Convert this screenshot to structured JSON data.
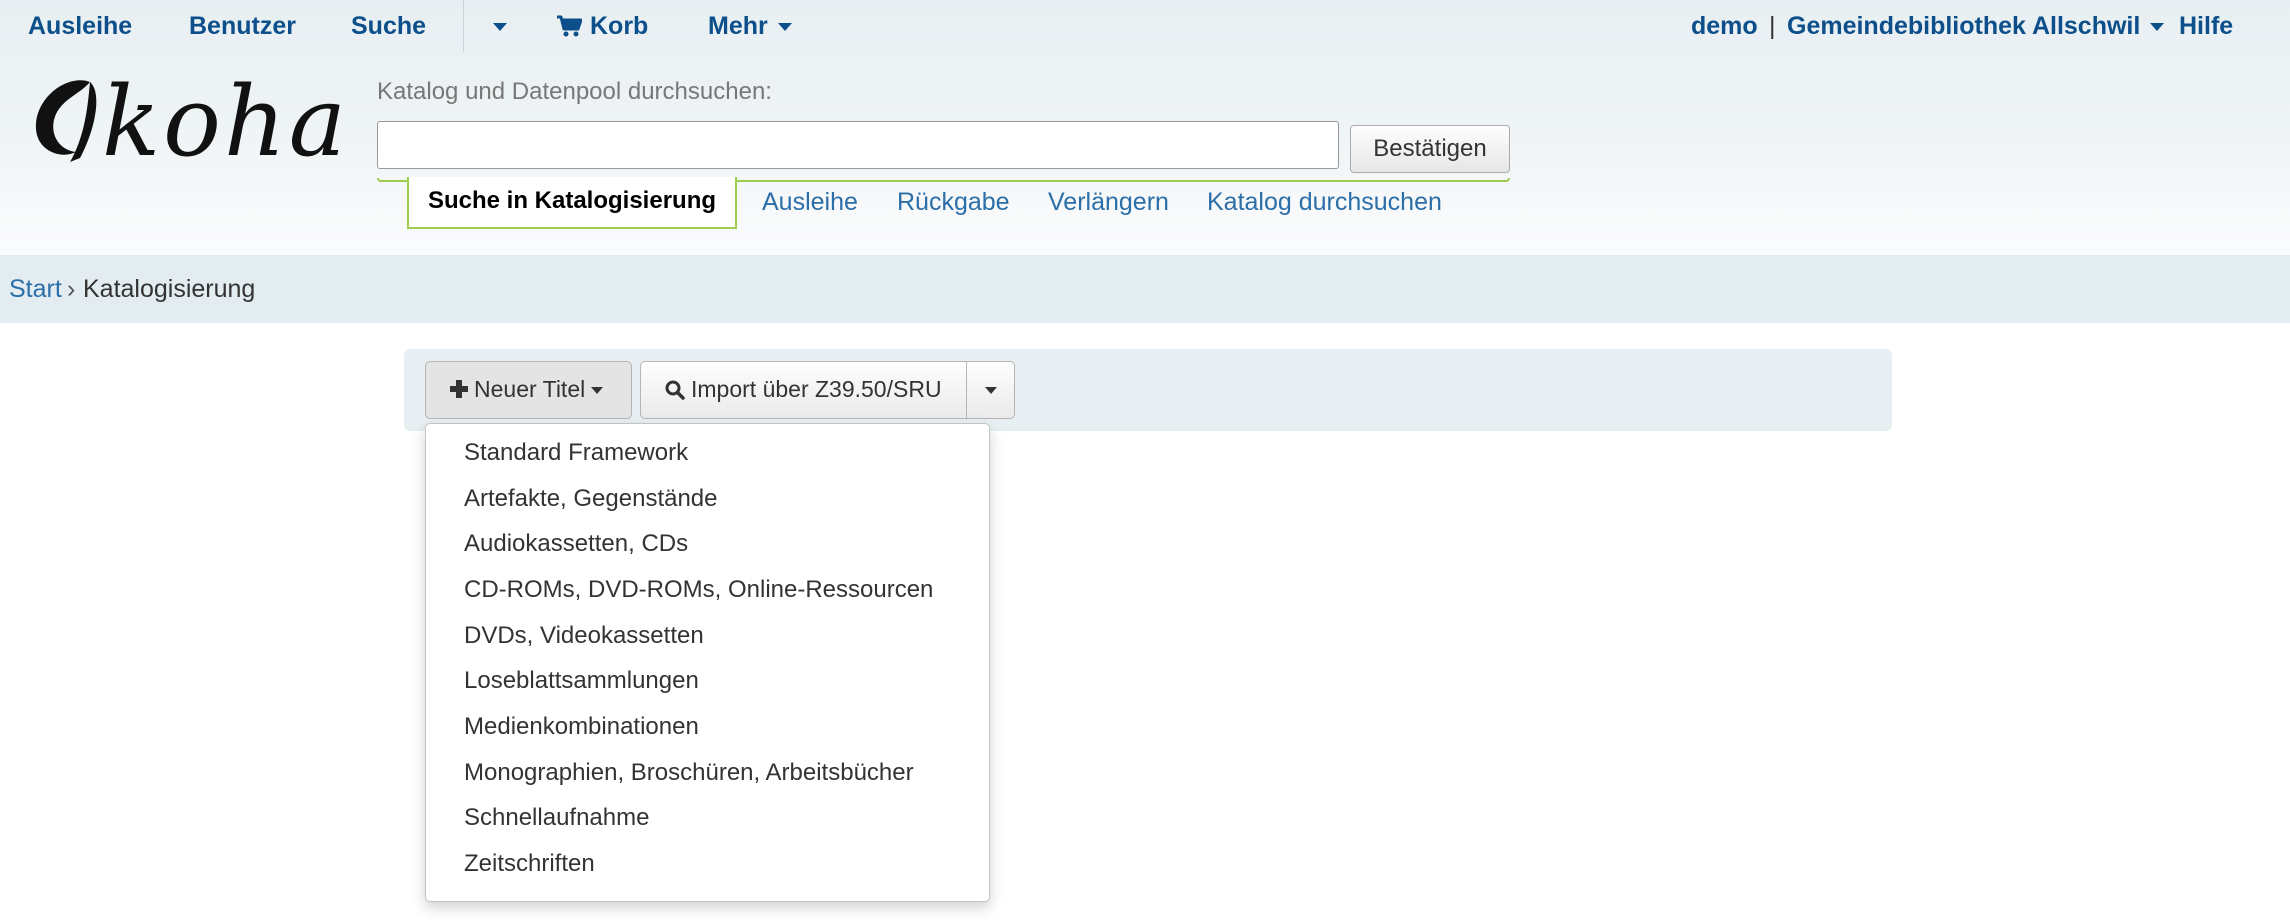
{
  "topnav": {
    "circulation": "Ausleihe",
    "patrons": "Benutzer",
    "search": "Suche",
    "cart": "Korb",
    "more": "Mehr",
    "user": "demo",
    "separator": "|",
    "library": "Gemeindebibliothek Allschwil",
    "help": "Hilfe"
  },
  "logo": {
    "text": "koha"
  },
  "search": {
    "label": "Katalog und Datenpool durchsuchen:",
    "value": "",
    "placeholder": "",
    "submit": "Bestätigen"
  },
  "tabs": {
    "active": "Suche in Katalogisierung",
    "items": [
      "Ausleihe",
      "Rückgabe",
      "Verlängern",
      "Katalog durchsuchen"
    ]
  },
  "breadcrumb": {
    "home": "Start",
    "separator": "›",
    "current": "Katalogisierung"
  },
  "toolbar": {
    "new_record": "Neuer Titel",
    "import": "Import über Z39.50/SRU"
  },
  "dropdown": {
    "items": [
      "Standard Framework",
      "Artefakte, Gegenstände",
      "Audiokassetten, CDs",
      "CD-ROMs, DVD-ROMs, Online-Ressourcen",
      "DVDs, Videokassetten",
      "Loseblattsammlungen",
      "Medienkombinationen",
      "Monographien, Broschüren, Arbeitsbücher",
      "Schnellaufnahme",
      "Zeitschriften"
    ]
  },
  "colors": {
    "link": "#2b6ea8",
    "nav": "#0d4f8b",
    "tab_border": "#9dcc4f",
    "breadcrumb_bg": "#e3ecf0"
  }
}
